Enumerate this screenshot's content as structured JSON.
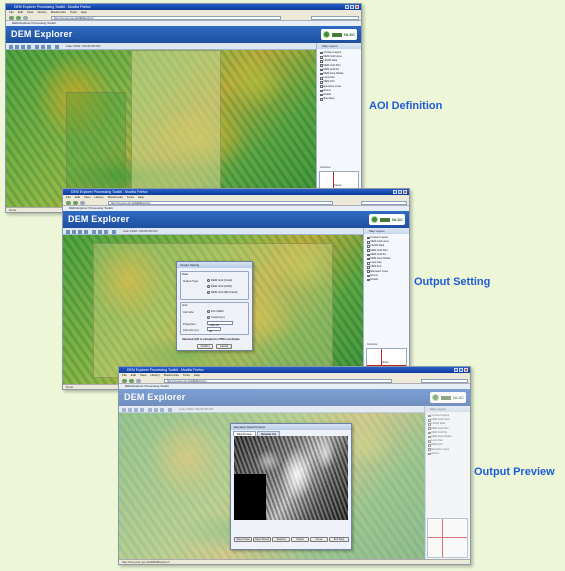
{
  "captions": {
    "aoi": "AOI Definition",
    "output_setting": "Output Setting",
    "output_preview": "Output Preview"
  },
  "app": {
    "title": "DEM Explorer"
  },
  "browser": {
    "window_title": "DEM Explorer Processing Toolkit - Mozilla Firefox",
    "menu": [
      "File",
      "Edit",
      "View",
      "History",
      "Bookmarks",
      "Tools",
      "Help"
    ],
    "address": "http://ssv.ucsc.gov.tw/DEMExplorer/",
    "tab": "DEM Explorer Processing Toolkit",
    "status": "Done",
    "status_url": "http://ssv.ucsc.gov.tw/DEMExplorer/"
  },
  "map_toolbar": {
    "label": "scale 1:9000 / 151200 500 000"
  },
  "layer_panel": {
    "header": "Map Layers",
    "items": [
      "Contour Layers",
      "DEM Grid Lines",
      "LiDAR Data",
      "DEM Grid 40m",
      "DEM Grid 5m",
      "DEM Area Shade",
      "Land Use",
      "DEM AOI",
      "Elevation Lines",
      "Rivers",
      "Roads",
      "Boundary"
    ]
  },
  "overview": {
    "label": "Overview",
    "place": "Taiwan"
  },
  "output_dialog": {
    "title": "Output Setting",
    "group_data": "Data",
    "data_type": "Output Type",
    "radio1": "DEM Grid (Float)",
    "radio2": "DEM Grid (16bit)",
    "radio3": "DEM Grid (8bit Float)",
    "group_grid": "Grid",
    "cell_size_label": "Cell size",
    "cell_opt1": "10m DEM",
    "cell_opt2": "Custom(m)",
    "projection_label": "Projection",
    "projection_value": "TWD 97",
    "cell_input_label": "Cell size (m)",
    "cell_input_value": "40",
    "note": "Selected AOI is included in DTM coordinate",
    "ok": "Confirm",
    "cancel": "Cancel"
  },
  "preview_dialog": {
    "title": "Elevation Data Preview",
    "tab_preview": "Data Preview",
    "tab_metadata": "Metadata Info",
    "buttons": [
      "Select Area",
      "Save Result",
      "Spacing",
      "Output",
      "Close",
      "Exit Stop"
    ]
  }
}
